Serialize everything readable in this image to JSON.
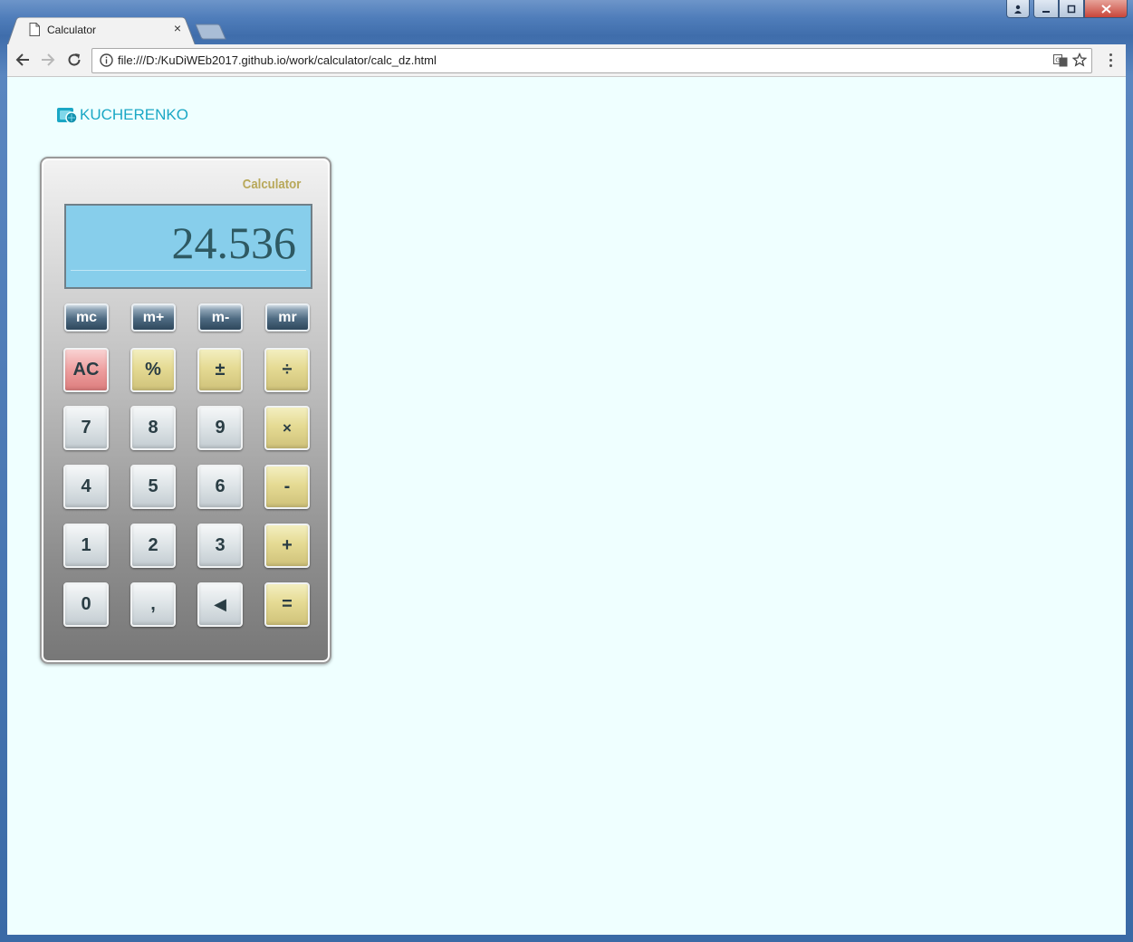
{
  "browser": {
    "tab_title": "Calculator",
    "tab_close": "×",
    "url": "file:///D:/KuDiWEb2017.github.io/work/calculator/calc_dz.html"
  },
  "page": {
    "logo_text": "KUCHERENKO",
    "calculator": {
      "title": "Calculator",
      "display_value": "24.536",
      "memory_buttons": [
        "mc",
        "m+",
        "m-",
        "mr"
      ],
      "keys": [
        [
          "AC",
          "%",
          "±",
          "÷"
        ],
        [
          "7",
          "8",
          "9",
          "×"
        ],
        [
          "4",
          "5",
          "6",
          "-"
        ],
        [
          "1",
          "2",
          "3",
          "+"
        ],
        [
          "0",
          ",",
          "◀",
          "="
        ]
      ]
    }
  },
  "colors": {
    "page_background": "#efffff",
    "display_background": "#87ceeb",
    "title_color": "#b8a85a",
    "logo_color": "#1aa7c5"
  },
  "icons": [
    "document-icon",
    "back-arrow-icon",
    "forward-arrow-icon",
    "reload-icon",
    "info-icon",
    "translate-icon",
    "star-icon",
    "menu-icon",
    "backspace-icon"
  ]
}
